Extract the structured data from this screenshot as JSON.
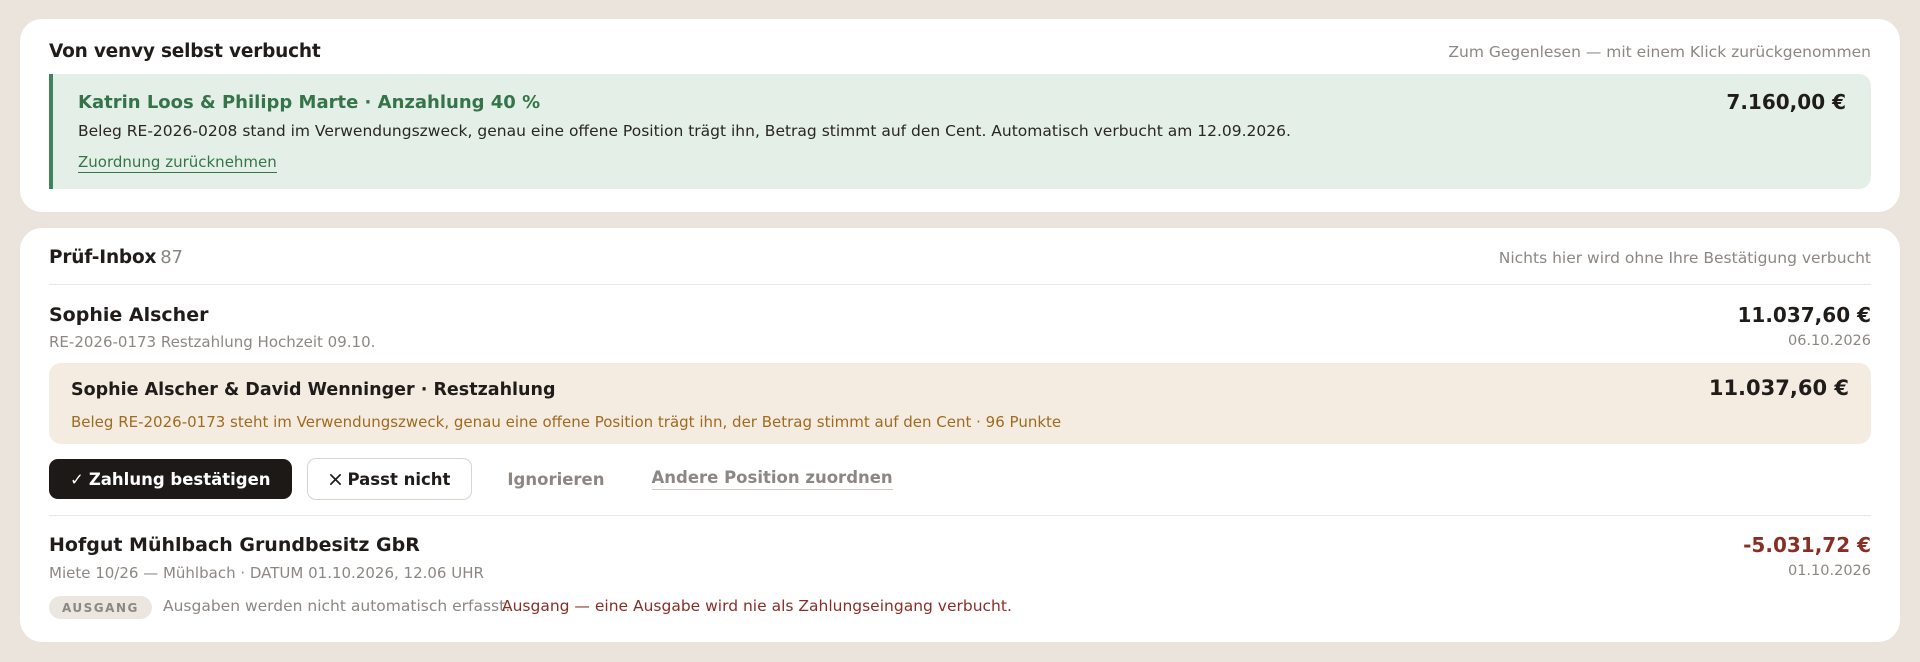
{
  "auto_section": {
    "title": "Von venvy selbst verbucht",
    "note": "Zum Gegenlesen — mit einem Klick zurückgenommen",
    "entry": {
      "title": "Katrin Loos & Philipp Marte · Anzahlung 40 %",
      "amount": "7.160,00 €",
      "description": "Beleg RE-2026-0208 stand im Verwendungszweck, genau eine offene Position trägt ihn, Betrag stimmt auf den Cent. Automatisch verbucht am 12.09.2026.",
      "undo_label": "Zuordnung zurücknehmen"
    },
    "accent_color": "#3f8458"
  },
  "inbox": {
    "title": "Prüf-Inbox",
    "count": "87",
    "note": "Nichts hier wird ohne Ihre Bestätigung verbucht",
    "items": [
      {
        "name": "Sophie Alscher",
        "reference": "RE-2026-0173 Restzahlung Hochzeit 09.10.",
        "amount": "11.037,60 €",
        "date": "06.10.2026",
        "match": {
          "title": "Sophie Alscher & David Wenninger · Restzahlung",
          "amount": "11.037,60 €",
          "description": "Beleg RE-2026-0173 steht im Verwendungszweck, genau eine offene Position trägt ihn, der Betrag stimmt auf den Cent · 96 Punkte"
        },
        "actions": {
          "confirm_label": "Zahlung bestätigen",
          "confirm_icon": "✓",
          "reject_label": "Passt nicht",
          "ignore_label": "Ignorieren",
          "reassign_label": "Andere Position zuordnen"
        }
      },
      {
        "name": "Hofgut Mühlbach Grundbesitz GbR",
        "reference": "Miete 10/26 — Mühlbach · DATUM 01.10.2026, 12.06 UHR",
        "amount": "-5.031,72 €",
        "date": "01.10.2026",
        "badge": "AUSGANG",
        "note": "Ausgaben werden nicht automatisch erfasst.",
        "warning": "Ausgang — eine Ausgabe wird nie als Zahlungseingang verbucht."
      }
    ],
    "negative_color": "#8a2e25",
    "match_highlight_color": "#a06a1f"
  }
}
